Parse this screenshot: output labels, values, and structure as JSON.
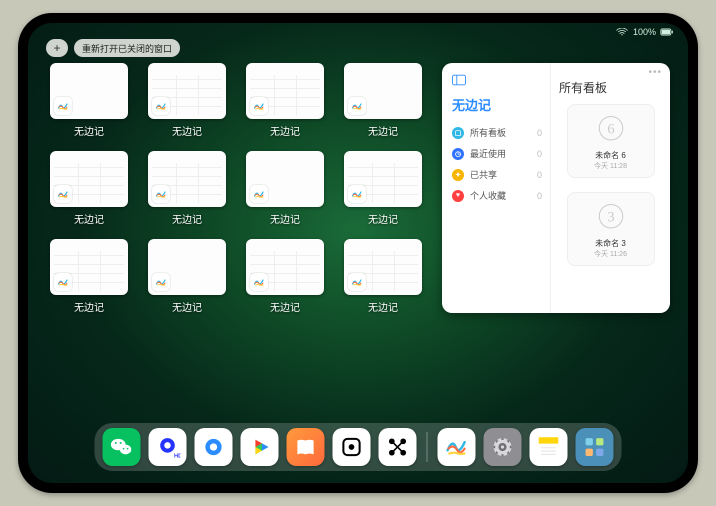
{
  "status": {
    "battery_text": "100%"
  },
  "topbar": {
    "plus_label": "+",
    "reopen_label": "重新打开已关闭的窗口"
  },
  "app_name": "无边记",
  "windows": [
    {
      "label": "无边记",
      "style": "blank"
    },
    {
      "label": "无边记",
      "style": "cal"
    },
    {
      "label": "无边记",
      "style": "cal"
    },
    {
      "label": "无边记",
      "style": "blank"
    },
    {
      "label": "无边记",
      "style": "cal"
    },
    {
      "label": "无边记",
      "style": "cal"
    },
    {
      "label": "无边记",
      "style": "blank"
    },
    {
      "label": "无边记",
      "style": "cal"
    },
    {
      "label": "无边记",
      "style": "cal"
    },
    {
      "label": "无边记",
      "style": "blank"
    },
    {
      "label": "无边记",
      "style": "cal"
    },
    {
      "label": "无边记",
      "style": "cal"
    }
  ],
  "sidepanel": {
    "left_title": "无边记",
    "right_title": "所有看板",
    "items": [
      {
        "icon_color": "#2fb8e6",
        "glyph": "▢",
        "label": "所有看板",
        "count": "0"
      },
      {
        "icon_color": "#2e72ff",
        "glyph": "◷",
        "label": "最近使用",
        "count": "0"
      },
      {
        "icon_color": "#f7b500",
        "glyph": "✦",
        "label": "已共享",
        "count": "0"
      },
      {
        "icon_color": "#ff4040",
        "glyph": "♥",
        "label": "个人收藏",
        "count": "0"
      }
    ],
    "boards": [
      {
        "name": "未命名 6",
        "date": "今天 11:28",
        "sketch": "6"
      },
      {
        "name": "未命名 3",
        "date": "今天 11:26",
        "sketch": "3"
      }
    ]
  },
  "dock": {
    "items": [
      {
        "name": "wechat-icon",
        "bg": "#07c160"
      },
      {
        "name": "quark-hd-icon",
        "bg": "#ffffff"
      },
      {
        "name": "quark-icon",
        "bg": "#ffffff"
      },
      {
        "name": "play-icon",
        "bg": "#ffffff"
      },
      {
        "name": "books-icon",
        "bg": "linear-gradient(135deg,#ff9a3c,#ff6a3c)"
      },
      {
        "name": "dice-icon",
        "bg": "#ffffff"
      },
      {
        "name": "share-icon",
        "bg": "#ffffff"
      },
      {
        "name": "freeform-icon",
        "bg": "#ffffff"
      },
      {
        "name": "settings-icon",
        "bg": "#8e8e93"
      },
      {
        "name": "notes-icon",
        "bg": "#ffffff"
      },
      {
        "name": "app-library-icon",
        "bg": "#4a90b8"
      }
    ]
  }
}
